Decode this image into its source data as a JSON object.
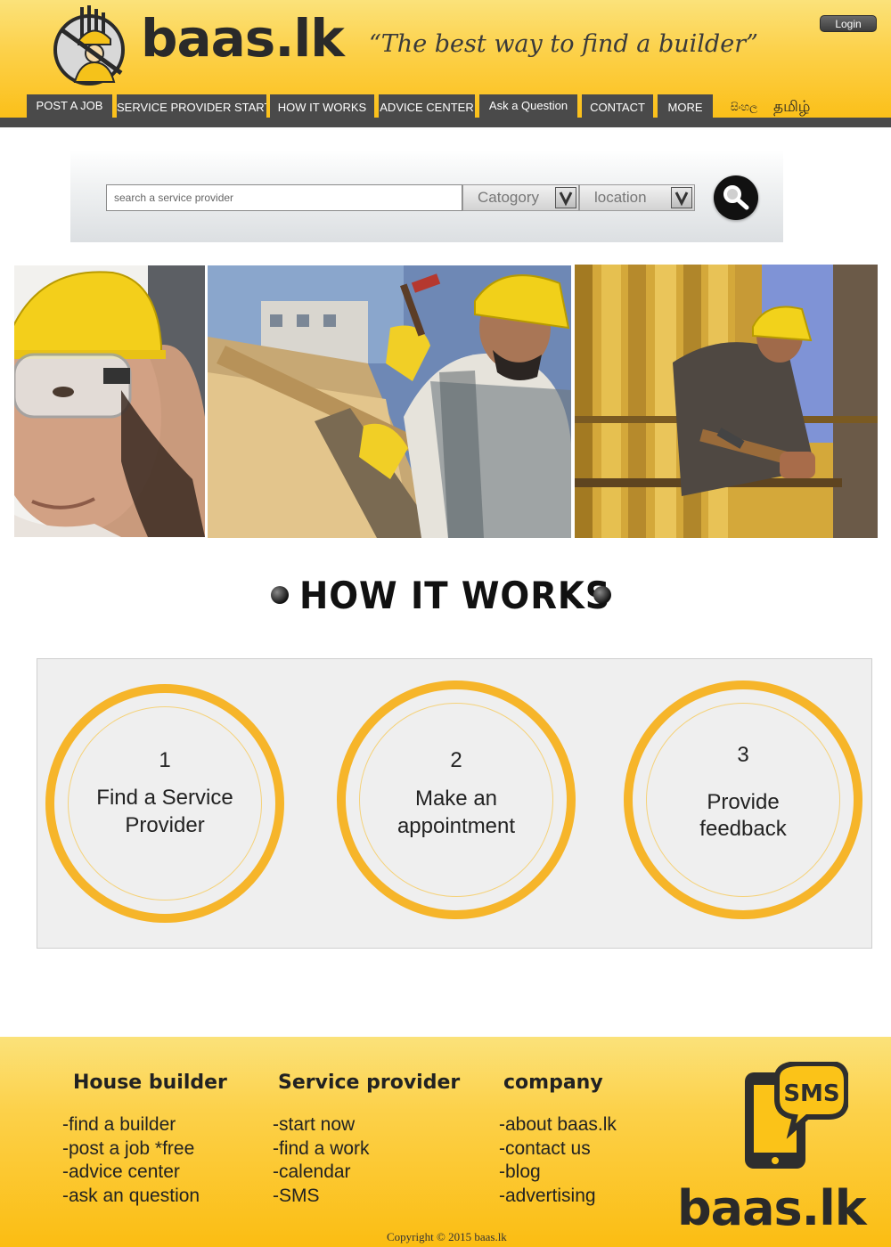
{
  "header": {
    "logo_text": "baas.lk",
    "tagline": "“The best way to find a builder”",
    "login_label": "Login"
  },
  "nav": {
    "items": [
      {
        "label": "POST A JOB"
      },
      {
        "label": "SERVICE PROVIDER START"
      },
      {
        "label": "HOW IT WORKS"
      },
      {
        "label": "ADVICE CENTER"
      },
      {
        "label": "Ask a Question"
      },
      {
        "label": "CONTACT"
      },
      {
        "label": "MORE"
      }
    ],
    "languages": [
      {
        "label": "සිංහල"
      },
      {
        "label": "தமிழ்"
      }
    ]
  },
  "search": {
    "placeholder": "search a service provider",
    "category_label": "Catogory",
    "location_label": "location"
  },
  "how_it_works": {
    "title": "HOW IT WORKS",
    "steps": [
      {
        "number": "1",
        "label_line1": "Find a Service",
        "label_line2": "Provider"
      },
      {
        "number": "2",
        "label_line1": "Make an",
        "label_line2": "appointment"
      },
      {
        "number": "3",
        "label_line1": "Provide",
        "label_line2": "feedback"
      }
    ]
  },
  "footer": {
    "columns": [
      {
        "heading": "House builder",
        "links": [
          "-find a builder",
          "-post a job *free",
          "-advice center",
          "-ask an question"
        ]
      },
      {
        "heading": "Service provider",
        "links": [
          "-start now",
          "-find a work",
          "-calendar",
          "-SMS"
        ]
      },
      {
        "heading": "company",
        "links": [
          "-about baas.lk",
          "-contact us",
          "-blog",
          "-advertising"
        ]
      }
    ],
    "sms_label": "SMS",
    "logo_text": "baas.lk",
    "copyright": "Copyright © 2015 baas.lk"
  },
  "colors": {
    "brand_yellow": "#fbbd12",
    "nav_gray": "#4a4a4a",
    "ring_orange": "#f6b52a"
  },
  "icons": [
    "builder-logo-icon",
    "search-icon",
    "chevron-down-icon",
    "sms-phone-icon",
    "bullet-dot-icon"
  ]
}
